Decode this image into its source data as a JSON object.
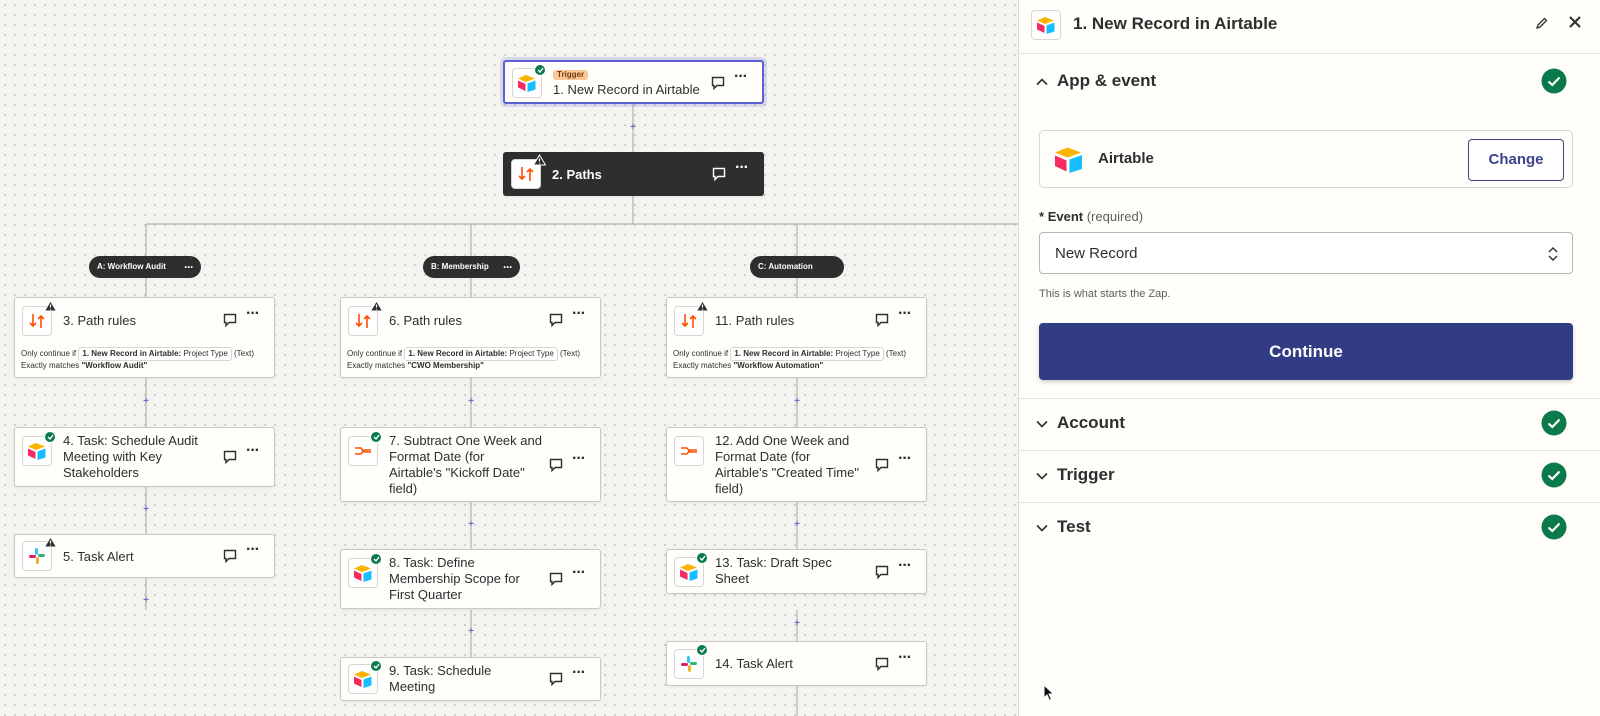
{
  "canvas": {
    "trigger_step": {
      "tag": "Trigger",
      "title": "1. New Record in Airtable"
    },
    "paths_step": {
      "title": "2. Paths"
    },
    "path_labels": [
      {
        "label": "A: Workflow Audit"
      },
      {
        "label": "B: Membership"
      },
      {
        "label": "C: Automation"
      }
    ],
    "column_a": {
      "rules": {
        "title": "3. Path rules",
        "cond_prefix": "Only continue if",
        "cond_field": "1. New Record in Airtable:",
        "cond_field_name": "Project Type",
        "cond_type": "(Text)",
        "match_prefix": "Exactly matches",
        "match_value": "\"Workflow Audit\""
      },
      "step4": {
        "title_l1": "4. Task: Schedule Audit",
        "title_l2": "Meeting with Key",
        "title_l3": "Stakeholders"
      },
      "step5": {
        "title": "5. Task Alert"
      }
    },
    "column_b": {
      "rules": {
        "title": "6. Path rules",
        "cond_prefix": "Only continue if",
        "cond_field": "1. New Record in Airtable:",
        "cond_field_name": "Project Type",
        "cond_type": "(Text)",
        "match_prefix": "Exactly matches",
        "match_value": "\"CWO Membership\""
      },
      "step7": {
        "title_l1": "7. Subtract One Week and",
        "title_l2": "Format Date (for",
        "title_l3": "Airtable's \"Kickoff Date\"",
        "title_l4": "field)"
      },
      "step8": {
        "title_l1": "8. Task: Define",
        "title_l2": "Membership Scope for",
        "title_l3": "First Quarter"
      },
      "step9": {
        "title_l1": "9. Task: Schedule",
        "title_l2": "Meeting"
      }
    },
    "column_c": {
      "rules": {
        "title": "11. Path rules",
        "cond_prefix": "Only continue if",
        "cond_field": "1. New Record in Airtable:",
        "cond_field_name": "Project Type",
        "cond_type": "(Text)",
        "match_prefix": "Exactly matches",
        "match_value": "\"Workflow Automation\""
      },
      "step12": {
        "title_l1": "12. Add One Week and",
        "title_l2": "Format Date (for",
        "title_l3": "Airtable's \"Created Time\"",
        "title_l4": "field)"
      },
      "step13": {
        "title_l1": "13. Task: Draft Spec",
        "title_l2": "Sheet"
      },
      "step14": {
        "title": "14. Task Alert"
      }
    },
    "plus_symbol": "+"
  },
  "panel": {
    "title": "1. New Record in Airtable",
    "sections": {
      "app_event": "App & event",
      "account": "Account",
      "trigger": "Trigger",
      "test": "Test"
    },
    "app": {
      "name": "Airtable",
      "change_label": "Change"
    },
    "event_field": {
      "star": "*",
      "label": "Event",
      "required": "(required)",
      "value": "New Record",
      "help": "This is what starts the Zap."
    },
    "continue_label": "Continue"
  },
  "colors": {
    "accent": "#323c85",
    "success": "#0b7a4b",
    "trigger_border": "#5a5fd4",
    "dark_node": "#2d2e2e",
    "zapier_orange": "#ff4f00"
  },
  "icons": [
    "airtable-icon",
    "paths-icon",
    "formatter-icon",
    "slack-icon",
    "comment-icon",
    "more-icon",
    "check-badge-icon",
    "warning-icon",
    "edit-icon",
    "close-icon",
    "chevron-up-icon",
    "chevron-down-icon",
    "select-arrows-icon",
    "cursor-icon"
  ]
}
